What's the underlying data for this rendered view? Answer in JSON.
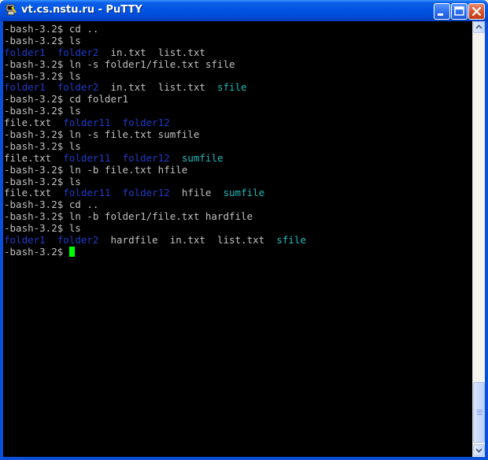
{
  "window": {
    "title": "vt.cs.nstu.ru - PuTTY"
  },
  "icons": {
    "app": "putty-terminal-icon",
    "minimize": "minimize-icon",
    "maximize": "maximize-icon",
    "close": "close-icon",
    "scroll_up": "arrow-up-icon",
    "scroll_down": "arrow-down-icon"
  },
  "colors": {
    "text": "#c0c0c0",
    "directory": "#1e3cc8",
    "symlink": "#22b8b8",
    "cursor": "#00ff00",
    "background": "#000000",
    "titlebar": "#0054e3"
  },
  "terminal": {
    "lines": [
      [
        {
          "t": "-bash-3.2$ cd ..",
          "c": "text"
        }
      ],
      [
        {
          "t": "-bash-3.2$ ls",
          "c": "text"
        }
      ],
      [
        {
          "t": "folder1",
          "c": "directory"
        },
        {
          "t": "  ",
          "c": "text"
        },
        {
          "t": "folder2",
          "c": "directory"
        },
        {
          "t": "  in.txt  list.txt",
          "c": "text"
        }
      ],
      [
        {
          "t": "-bash-3.2$ ln -s folder1/file.txt sfile",
          "c": "text"
        }
      ],
      [
        {
          "t": "-bash-3.2$ ls",
          "c": "text"
        }
      ],
      [
        {
          "t": "folder1",
          "c": "directory"
        },
        {
          "t": "  ",
          "c": "text"
        },
        {
          "t": "folder2",
          "c": "directory"
        },
        {
          "t": "  in.txt  list.txt  ",
          "c": "text"
        },
        {
          "t": "sfile",
          "c": "symlink"
        }
      ],
      [
        {
          "t": "-bash-3.2$ cd folder1",
          "c": "text"
        }
      ],
      [
        {
          "t": "-bash-3.2$ ls",
          "c": "text"
        }
      ],
      [
        {
          "t": "file.txt  ",
          "c": "text"
        },
        {
          "t": "folder11",
          "c": "directory"
        },
        {
          "t": "  ",
          "c": "text"
        },
        {
          "t": "folder12",
          "c": "directory"
        }
      ],
      [
        {
          "t": "-bash-3.2$ ln -s file.txt sumfile",
          "c": "text"
        }
      ],
      [
        {
          "t": "-bash-3.2$ ls",
          "c": "text"
        }
      ],
      [
        {
          "t": "file.txt  ",
          "c": "text"
        },
        {
          "t": "folder11",
          "c": "directory"
        },
        {
          "t": "  ",
          "c": "text"
        },
        {
          "t": "folder12",
          "c": "directory"
        },
        {
          "t": "  ",
          "c": "text"
        },
        {
          "t": "sumfile",
          "c": "symlink"
        }
      ],
      [
        {
          "t": "-bash-3.2$ ln -b file.txt hfile",
          "c": "text"
        }
      ],
      [
        {
          "t": "-bash-3.2$ ls",
          "c": "text"
        }
      ],
      [
        {
          "t": "file.txt  ",
          "c": "text"
        },
        {
          "t": "folder11",
          "c": "directory"
        },
        {
          "t": "  ",
          "c": "text"
        },
        {
          "t": "folder12",
          "c": "directory"
        },
        {
          "t": "  hfile  ",
          "c": "text"
        },
        {
          "t": "sumfile",
          "c": "symlink"
        }
      ],
      [
        {
          "t": "-bash-3.2$ cd ..",
          "c": "text"
        }
      ],
      [
        {
          "t": "-bash-3.2$ ln -b folder1/file.txt hardfile",
          "c": "text"
        }
      ],
      [
        {
          "t": "-bash-3.2$ ls",
          "c": "text"
        }
      ],
      [
        {
          "t": "folder1",
          "c": "directory"
        },
        {
          "t": "  ",
          "c": "text"
        },
        {
          "t": "folder2",
          "c": "directory"
        },
        {
          "t": "  hardfile  in.txt  list.txt  ",
          "c": "text"
        },
        {
          "t": "sfile",
          "c": "symlink"
        }
      ],
      [
        {
          "t": "-bash-3.2$ ",
          "c": "text"
        },
        {
          "t": "",
          "c": "cursor"
        }
      ]
    ]
  }
}
